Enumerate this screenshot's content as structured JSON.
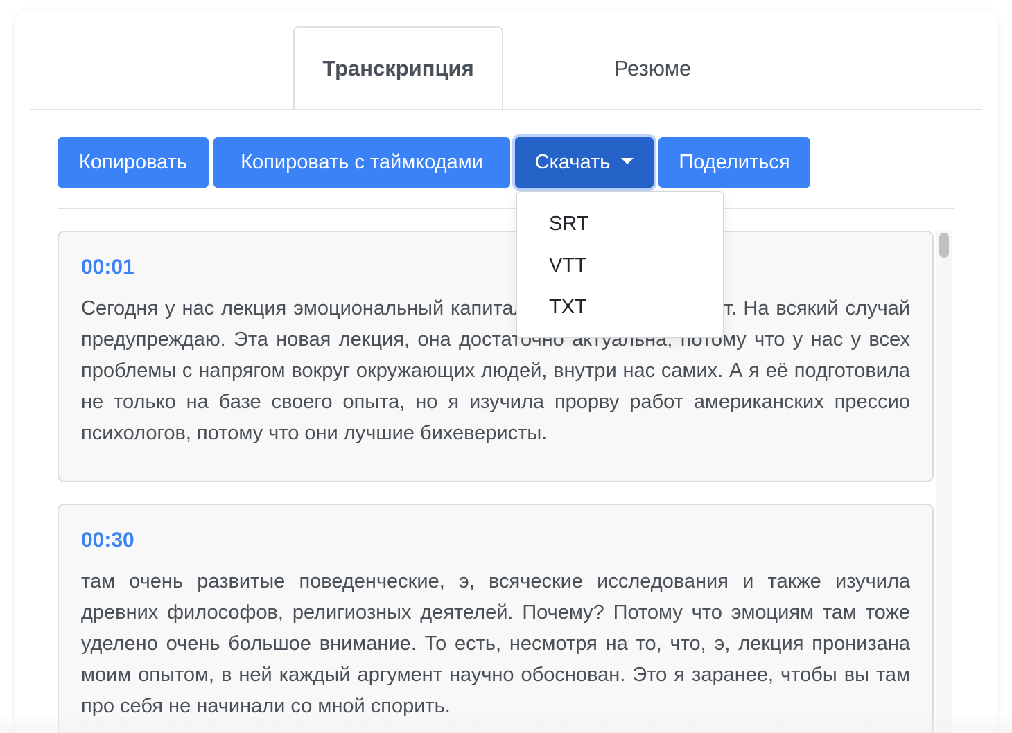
{
  "tabs": [
    {
      "label": "Транскрипция",
      "active": true
    },
    {
      "label": "Резюме",
      "active": false
    }
  ],
  "toolbar": {
    "copy_label": "Копировать",
    "copy_timecodes_label": "Копировать с таймкодами",
    "download_label": "Скачать",
    "share_label": "Поделиться"
  },
  "download_menu": {
    "open": true,
    "items": [
      "SRT",
      "VTT",
      "TXT"
    ]
  },
  "segments": [
    {
      "time": "00:01",
      "text": "Сегодня у нас лекция эмоциональный капитал, которому уже 10 лет. На всякий случай предупреждаю. Эта новая лекция, она достаточно актуальна, потому что у нас у всех проблемы с напрягом вокруг окружающих людей, внутри нас самих. А я её подготовила не только на базе своего опыта, но я изучила прорву работ американских прессио психологов, потому что они лучшие бихеверисты."
    },
    {
      "time": "00:30",
      "text": "там очень развитые поведенческие, э, всяческие исследования и также изучила древних философов, религиозных деятелей. Почему? Потому что эмоциям там тоже уделено очень большое внимание. То есть, несмотря на то, что, э, лекция пронизана моим опытом, в ней каждый аргумент научно обоснован. Это я заранее, чтобы вы там про себя не начинали со мной спорить."
    }
  ],
  "colors": {
    "primary": "#3b82f6",
    "primary_active": "#2563c9",
    "timestamp": "#3b82f6",
    "text": "#495057"
  }
}
